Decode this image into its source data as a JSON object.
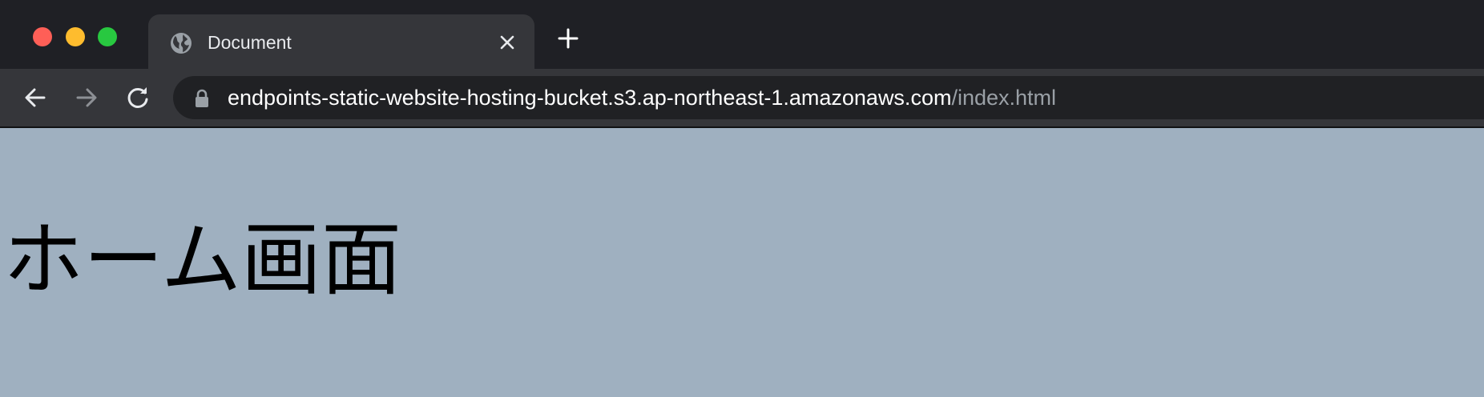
{
  "browser": {
    "tab": {
      "title": "Document",
      "favicon": "globe-icon"
    },
    "address_bar": {
      "host": "endpoints-static-website-hosting-bucket.s3.ap-northeast-1.amazonaws.com",
      "path": "/index.html"
    },
    "icons": {
      "back": "arrow-left-icon",
      "forward": "arrow-right-icon",
      "reload": "reload-icon",
      "lock": "lock-icon",
      "close_tab": "close-icon",
      "new_tab": "plus-icon"
    },
    "colors": {
      "close": "#fe5f57",
      "minimize": "#febc2e",
      "zoom": "#28c840",
      "chrome_dark": "#1f2025",
      "chrome_tab": "#35363a",
      "omnibox": "#202124"
    }
  },
  "page": {
    "heading": "ホーム画面",
    "background": "#9fb0c0"
  }
}
